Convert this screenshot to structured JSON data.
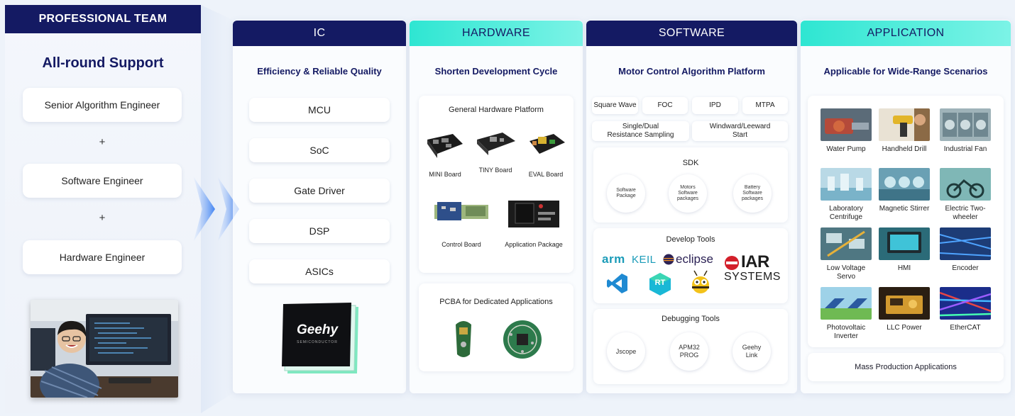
{
  "team": {
    "header": "PROFESSIONAL TEAM",
    "title": "All-round Support",
    "roles": [
      "Senior Algorithm Engineer",
      "Software Engineer",
      "Hardware Engineer"
    ],
    "plus": "+"
  },
  "ic": {
    "header": "IC",
    "subtitle": "Efficiency & Reliable Quality",
    "items": [
      "MCU",
      "SoC",
      "Gate Driver",
      "DSP",
      "ASICs"
    ],
    "chip_logo": "Geehy",
    "chip_sub": "SEMICONDUCTOR"
  },
  "hardware": {
    "header": "HARDWARE",
    "subtitle": "Shorten Development Cycle",
    "platform_title": "General Hardware Platform",
    "boards": [
      "MINI Board",
      "TINY Board",
      "EVAL Board",
      "Control Board",
      "Application Package"
    ],
    "pcba_title": "PCBA for Dedicated Applications"
  },
  "software": {
    "header": "SOFTWARE",
    "subtitle": "Motor Control Algorithm Platform",
    "tags": [
      "Square Wave",
      "FOC",
      "IPD",
      "MTPA",
      "Single/Dual Resistance Sampling",
      "Windward/Leeward Start"
    ],
    "sdk_title": "SDK",
    "sdk_items": [
      "Software Package",
      "Motors Software packages",
      "Battery Software packages"
    ],
    "dev_title": "Develop Tools",
    "dev_logos": [
      "arm",
      "KEIL",
      "eclipse",
      "IAR",
      "SYSTEMS",
      "RT"
    ],
    "debug_title": "Debugging Tools",
    "debug_items": [
      "Jscope",
      "APM32 PROG",
      "Geehy Link"
    ]
  },
  "application": {
    "header": "APPLICATION",
    "subtitle": "Applicable for Wide-Range Scenarios",
    "apps": [
      "Water Pump",
      "Handheld Drill",
      "Industrial Fan",
      "Laboratory Centrifuge",
      "Magnetic Stirrer",
      "Electric Two-wheeler",
      "Low Voltage Servo",
      "HMI",
      "Encoder",
      "Photovoltaic Inverter",
      "LLC Power",
      "EtherCAT"
    ],
    "mass": "Mass Production Applications"
  },
  "colors": {
    "navy": "#141a63",
    "teal": "#2ee6d2"
  }
}
